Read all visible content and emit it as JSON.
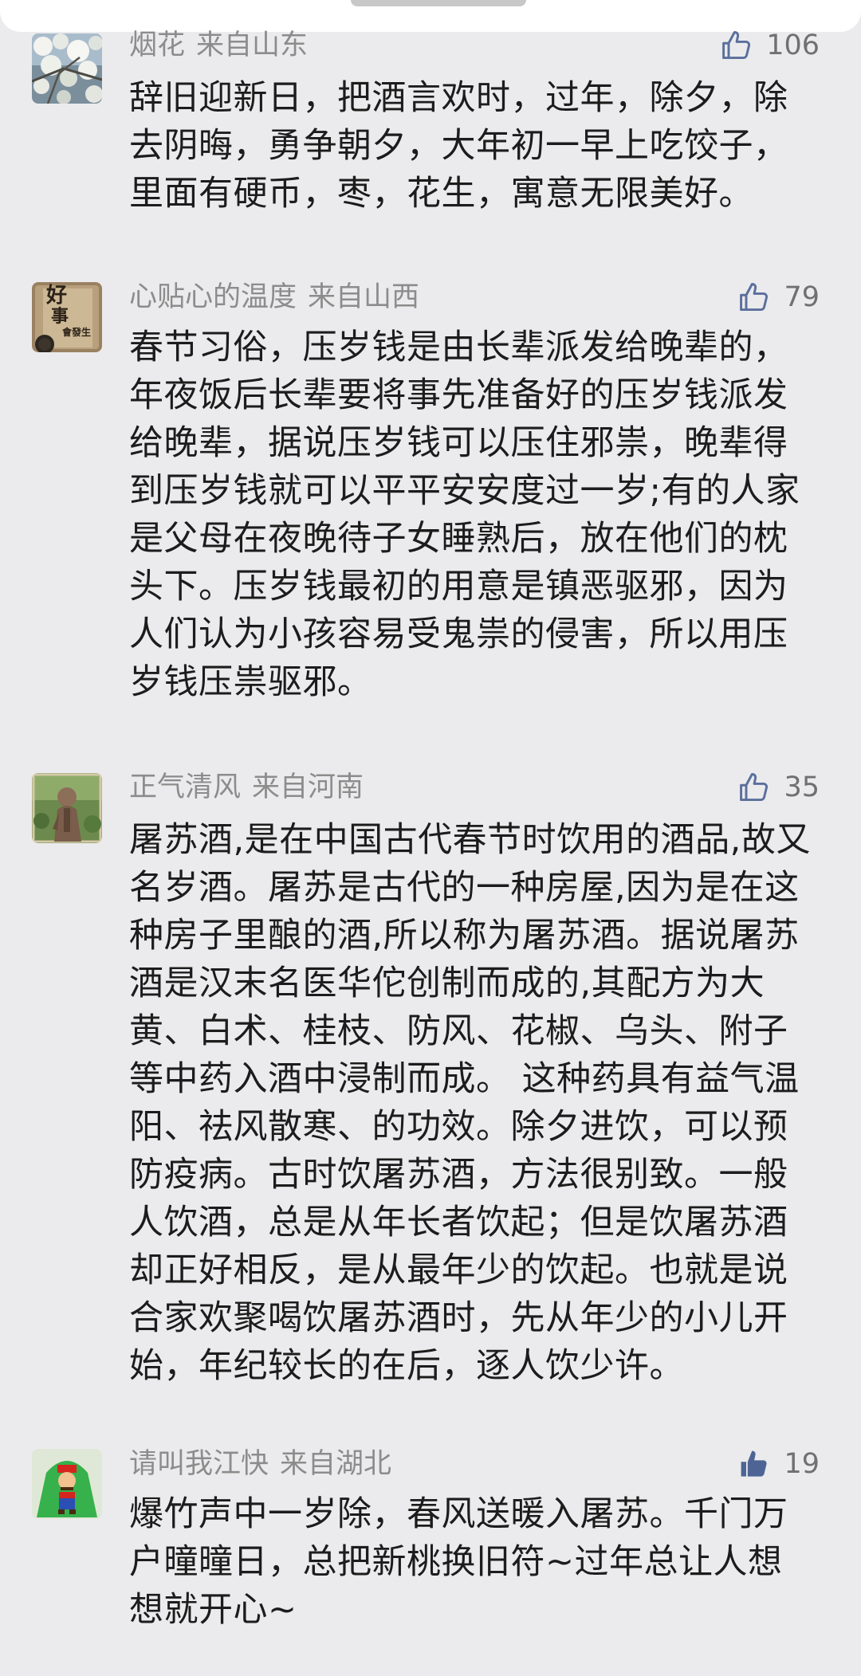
{
  "comments": [
    {
      "username": "烟花",
      "location": "来自山东",
      "likes": "106",
      "liked": false,
      "text": "辞旧迎新日，把酒言欢时，过年，除夕，除\n去阴晦，勇争朝夕，大年初一早上吃饺子，\n里面有硬币，枣，花生，寓意无限美好。"
    },
    {
      "username": "心贴心的温度",
      "location": "来自山西",
      "likes": "79",
      "liked": false,
      "avatar_text": [
        "好",
        "事",
        "會發生"
      ],
      "text": "春节习俗，压岁钱是由长辈派发给晚辈的，\n年夜饭后长辈要将事先准备好的压岁钱派发\n给晚辈，据说压岁钱可以压住邪祟，晚辈得\n到压岁钱就可以平平安安度过一岁;有的人家\n是父母在夜晚待子女睡熟后，放在他们的枕\n头下。压岁钱最初的用意是镇恶驱邪，因为\n人们认为小孩容易受鬼祟的侵害，所以用压\n岁钱压祟驱邪。"
    },
    {
      "username": "正气清风",
      "location": "来自河南",
      "likes": "35",
      "liked": false,
      "text": "屠苏酒,是在中国古代春节时饮用的酒品,故又\n名岁酒。屠苏是古代的一种房屋,因为是在这\n种房子里酿的酒,所以称为屠苏酒。据说屠苏\n酒是汉末名医华佗创制而成的,其配方为大\n黄、白术、桂枝、防风、花椒、乌头、附子\n等中药入酒中浸制而成。 这种药具有益气温\n阳、祛风散寒、的功效。除夕进饮，可以预\n防疫病。古时饮屠苏酒，方法很别致。一般\n人饮酒，总是从年长者饮起；但是饮屠苏酒\n却正好相反，是从最年少的饮起。也就是说\n合家欢聚喝饮屠苏酒时，先从年少的小儿开\n始，年纪较长的在后，逐人饮少许。"
    },
    {
      "username": "请叫我江快",
      "location": "来自湖北",
      "likes": "19",
      "liked": true,
      "text": "爆竹声中一岁除，春风送暖入屠苏。千门万\n户曈曈日，总把新桃换旧符~过年总让人想\n想就开心~"
    }
  ],
  "colors": {
    "background": "#ebebed",
    "meta_gray": "#8c8c8c",
    "like_outline": "#5b6f9c",
    "like_filled": "#4e6494",
    "text": "#1c1c1c"
  },
  "icons": {
    "like_outline": "thumbs-up-outline-icon",
    "like_filled": "thumbs-up-filled-icon"
  }
}
